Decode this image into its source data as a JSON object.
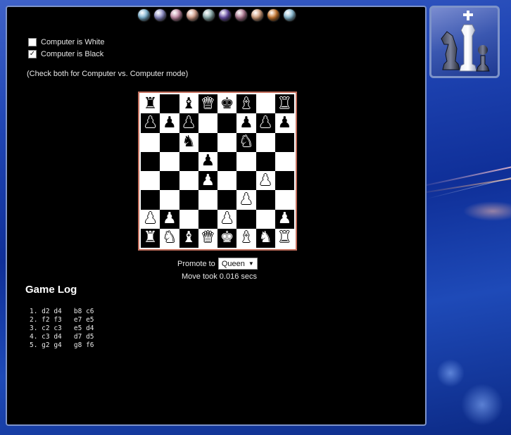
{
  "orbs": [
    "#7fb6d4",
    "#8f8fc8",
    "#c48aa6",
    "#d4a08c",
    "#8fb0b0",
    "#6a4fa8",
    "#b07a94",
    "#d4a07e",
    "#c87830",
    "#8fc0d8"
  ],
  "options": {
    "computer_white_label": "Computer is White",
    "computer_white_checked": false,
    "computer_black_label": "Computer is Black",
    "computer_black_checked": true,
    "hint": "(Check both for Computer vs. Computer mode)"
  },
  "board": {
    "rows": [
      [
        "bR",
        "",
        "bB",
        "bQ",
        "bK",
        "bB",
        "",
        "bR"
      ],
      [
        "bP",
        "bP",
        "bP",
        "",
        "",
        "bP",
        "bP",
        "bP"
      ],
      [
        "",
        "",
        "bN",
        "",
        "",
        "bN",
        "",
        ""
      ],
      [
        "",
        "",
        "",
        "bP",
        "",
        "",
        "",
        ""
      ],
      [
        "",
        "",
        "",
        "wP",
        "",
        "",
        "wP",
        ""
      ],
      [
        "",
        "",
        "",
        "",
        "",
        "wP",
        "",
        ""
      ],
      [
        "wP",
        "wP",
        "",
        "",
        "wP",
        "",
        "",
        "wP"
      ],
      [
        "wR",
        "wN",
        "wB",
        "wQ",
        "wK",
        "wB",
        "wN",
        "wR"
      ]
    ]
  },
  "promote": {
    "label": "Promote to",
    "selected": "Queen"
  },
  "timing": "Move took 0.016 secs",
  "game_log": {
    "title": "Game Log",
    "moves": [
      "1. d2 d4   b8 c6",
      "2. f2 f3   e7 e5",
      "3. c2 c3   e5 d4",
      "4. c3 d4   d7 d5",
      "5. g2 g4   g8 f6"
    ]
  }
}
